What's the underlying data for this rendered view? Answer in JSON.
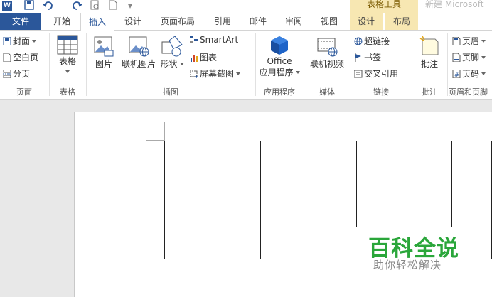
{
  "quick_access": {
    "save_icon": "save-icon",
    "undo_icon": "undo-icon",
    "redo_icon": "redo-icon",
    "print_preview_icon": "print-preview-icon",
    "new_doc_icon": "new-document-icon",
    "customize_icon": "customize-qat-icon"
  },
  "title_bar": {
    "context_title": "表格工具",
    "doc_title": "新建 Microsoft"
  },
  "tabs": {
    "file": "文件",
    "home": "开始",
    "insert": "插入",
    "design": "设计",
    "layout": "页面布局",
    "references": "引用",
    "mailings": "邮件",
    "review": "审阅",
    "view": "视图",
    "table_design": "设计",
    "table_layout": "布局"
  },
  "ribbon": {
    "pages": {
      "cover": "封面",
      "blank": "空白页",
      "break": "分页",
      "label": "页面"
    },
    "tables": {
      "table": "表格",
      "label": "表格"
    },
    "illustrations": {
      "picture": "图片",
      "online_picture": "联机图片",
      "shapes": "形状",
      "smartart": "SmartArt",
      "chart": "图表",
      "screenshot": "屏幕截图",
      "label": "插图"
    },
    "apps": {
      "office_line1": "Office",
      "office_line2": "应用程序",
      "label": "应用程序"
    },
    "media": {
      "online_video": "联机视频",
      "label": "媒体"
    },
    "links": {
      "hyperlink": "超链接",
      "bookmark": "书签",
      "crossref": "交叉引用",
      "label": "链接"
    },
    "comments": {
      "comment": "批注",
      "label": "批注"
    },
    "header_footer": {
      "header": "页眉",
      "footer": "页脚",
      "page_number": "页码",
      "label": "页眉和页脚"
    }
  },
  "document": {
    "table_rows": 3,
    "table_cols": 4
  },
  "watermark": {
    "main": "百科全说",
    "sub": "助你轻松解决"
  },
  "colors": {
    "word_blue": "#2b579a",
    "context_tab": "#f7e7b2",
    "watermark_green": "#2aa63a"
  }
}
